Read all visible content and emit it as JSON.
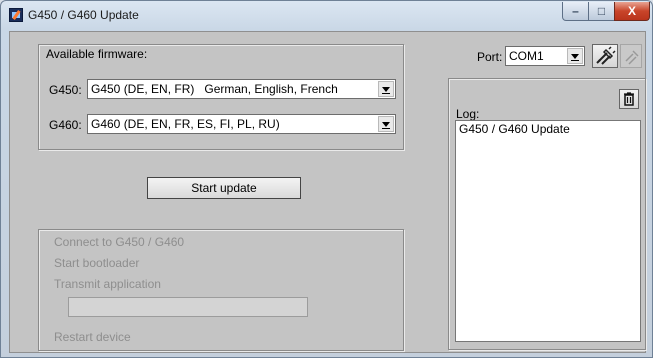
{
  "window": {
    "title": "G450 / G460 Update",
    "min_label": "–",
    "max_label": "□",
    "close_label": "X"
  },
  "firmware": {
    "group_title": "Available firmware:",
    "g450": {
      "label": "G450:",
      "selected": "G450 (DE, EN, FR)   German, English, French"
    },
    "g460": {
      "label": "G460:",
      "selected": "G460 (DE, EN, FR, ES, FI, PL, RU)"
    }
  },
  "actions": {
    "start_label": "Start update"
  },
  "steps": {
    "items": [
      "Connect to G450 / G460",
      "Start bootloader",
      "Transmit application",
      "Restart device"
    ],
    "progress_fraction": 0
  },
  "port": {
    "label": "Port:",
    "selected": "COM1",
    "connect_icon": "plug-icon",
    "disconnect_icon": "unplug-icon"
  },
  "log": {
    "label": "Log:",
    "lines": [
      "G450 / G460 Update"
    ],
    "clear_icon": "trash-icon"
  },
  "colors": {
    "close_button": "#c9452a",
    "panel_bg": "#c4c4c4",
    "disabled_text": "#8e8e8e"
  }
}
